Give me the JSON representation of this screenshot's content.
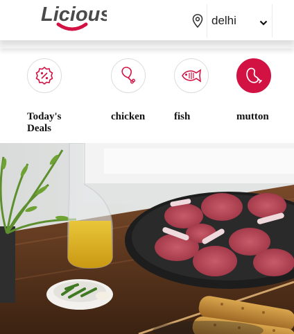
{
  "brand": {
    "name": "Licious",
    "logo_color": "#4a4a4a",
    "smile_color": "#d11243"
  },
  "location": {
    "icon": "location-pin-icon",
    "city": "delhi",
    "dropdown_icon": "chevron-down-icon"
  },
  "categories": [
    {
      "label": "Today's Deals",
      "icon": "deals-badge-icon",
      "active": false
    },
    {
      "label": "chicken",
      "icon": "chicken-leg-icon",
      "active": false
    },
    {
      "label": "fish",
      "icon": "fish-icon",
      "active": false
    },
    {
      "label": "mutton",
      "icon": "mutton-icon",
      "active": true
    }
  ],
  "colors": {
    "accent": "#d11243",
    "background": "#ffffff"
  },
  "hero": {
    "icon": "hero-banner-image"
  }
}
